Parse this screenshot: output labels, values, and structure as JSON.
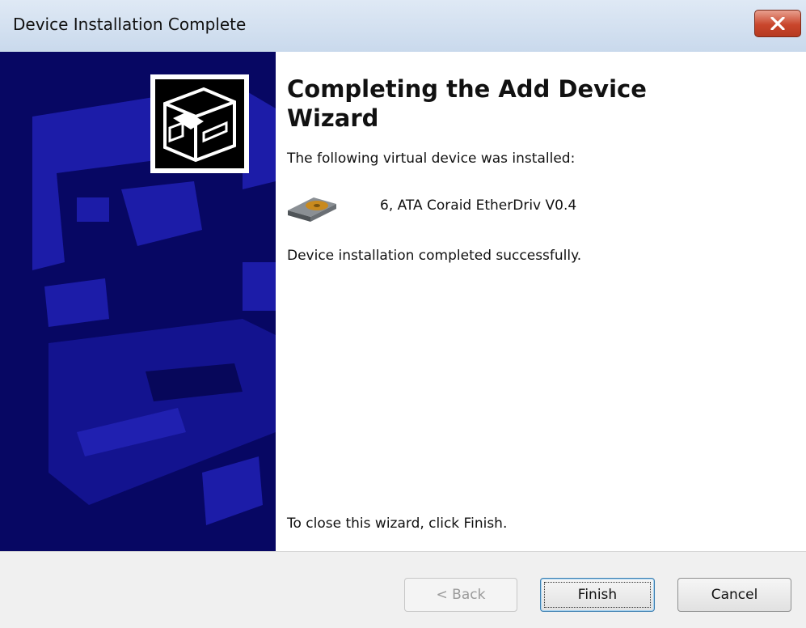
{
  "window": {
    "title": "Device Installation Complete"
  },
  "wizard": {
    "heading": "Completing the Add Device Wizard",
    "intro": "The following virtual device was installed:",
    "device_name": "6, ATA Coraid EtherDriv V0.4",
    "status": "Device installation completed successfully.",
    "close_hint": "To close this wizard, click Finish."
  },
  "buttons": {
    "back": "< Back",
    "finish": "Finish",
    "cancel": "Cancel"
  },
  "icons": {
    "close": "close-icon",
    "wizard": "computer-drive-icon",
    "device": "hard-drive-icon"
  },
  "colors": {
    "banner": "#070763",
    "banner_shapes": "#1c1ca8"
  }
}
